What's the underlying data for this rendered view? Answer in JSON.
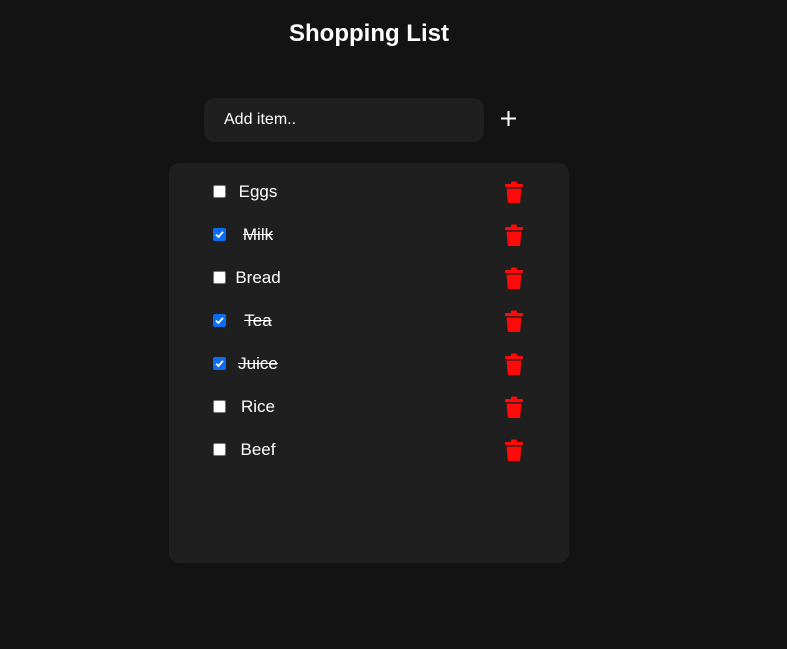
{
  "header": {
    "title": "Shopping List"
  },
  "add_form": {
    "placeholder": "Add item..",
    "add_icon": "plus-icon"
  },
  "colors": {
    "background": "#131313",
    "panel": "#1f1f1f",
    "checkbox_checked": "#0b6cf5",
    "delete_icon": "#ff0a0a"
  },
  "items": [
    {
      "label": "Eggs",
      "checked": false
    },
    {
      "label": "Milk",
      "checked": true
    },
    {
      "label": "Bread",
      "checked": false
    },
    {
      "label": "Tea",
      "checked": true
    },
    {
      "label": "Juice",
      "checked": true
    },
    {
      "label": "Rice",
      "checked": false
    },
    {
      "label": "Beef",
      "checked": false
    }
  ],
  "item_icons": {
    "delete": "trash-icon"
  }
}
